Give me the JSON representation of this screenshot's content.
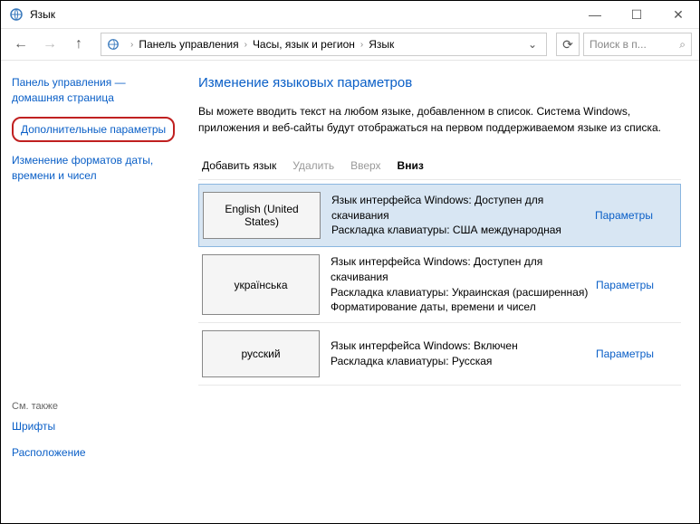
{
  "window": {
    "title": "Язык",
    "min": "—",
    "max": "☐",
    "close": "✕"
  },
  "nav": {
    "back": "←",
    "forward": "→",
    "up": "↑",
    "refresh": "⟳",
    "dropdown": "⌄",
    "search_placeholder": "Поиск в п...",
    "search_icon": "🔍",
    "breadcrumb": [
      "Панель управления",
      "Часы, язык и регион",
      "Язык"
    ]
  },
  "sidebar": {
    "home": "Панель управления — домашняя страница",
    "advanced": "Дополнительные параметры",
    "formats": "Изменение форматов даты, времени и чисел",
    "see_also_label": "См. также",
    "see_also": [
      "Шрифты",
      "Расположение"
    ]
  },
  "main": {
    "heading": "Изменение языковых параметров",
    "description": "Вы можете вводить текст на любом языке, добавленном в список. Система Windows, приложения и веб-сайты будут отображаться на первом поддерживаемом языке из списка.",
    "toolbar": {
      "add": "Добавить язык",
      "remove": "Удалить",
      "up": "Вверх",
      "down": "Вниз"
    },
    "options_label": "Параметры",
    "languages": [
      {
        "name": "English (United States)",
        "details": "Язык интерфейса Windows: Доступен для скачивания\nРаскладка клавиатуры: США международная",
        "selected": true
      },
      {
        "name": "українська",
        "details": "Язык интерфейса Windows: Доступен для скачивания\nРаскладка клавиатуры: Украинская (расширенная)\nФорматирование даты, времени и чисел",
        "selected": false
      },
      {
        "name": "русский",
        "details": "Язык интерфейса Windows: Включен\nРаскладка клавиатуры: Русская",
        "selected": false
      }
    ]
  }
}
